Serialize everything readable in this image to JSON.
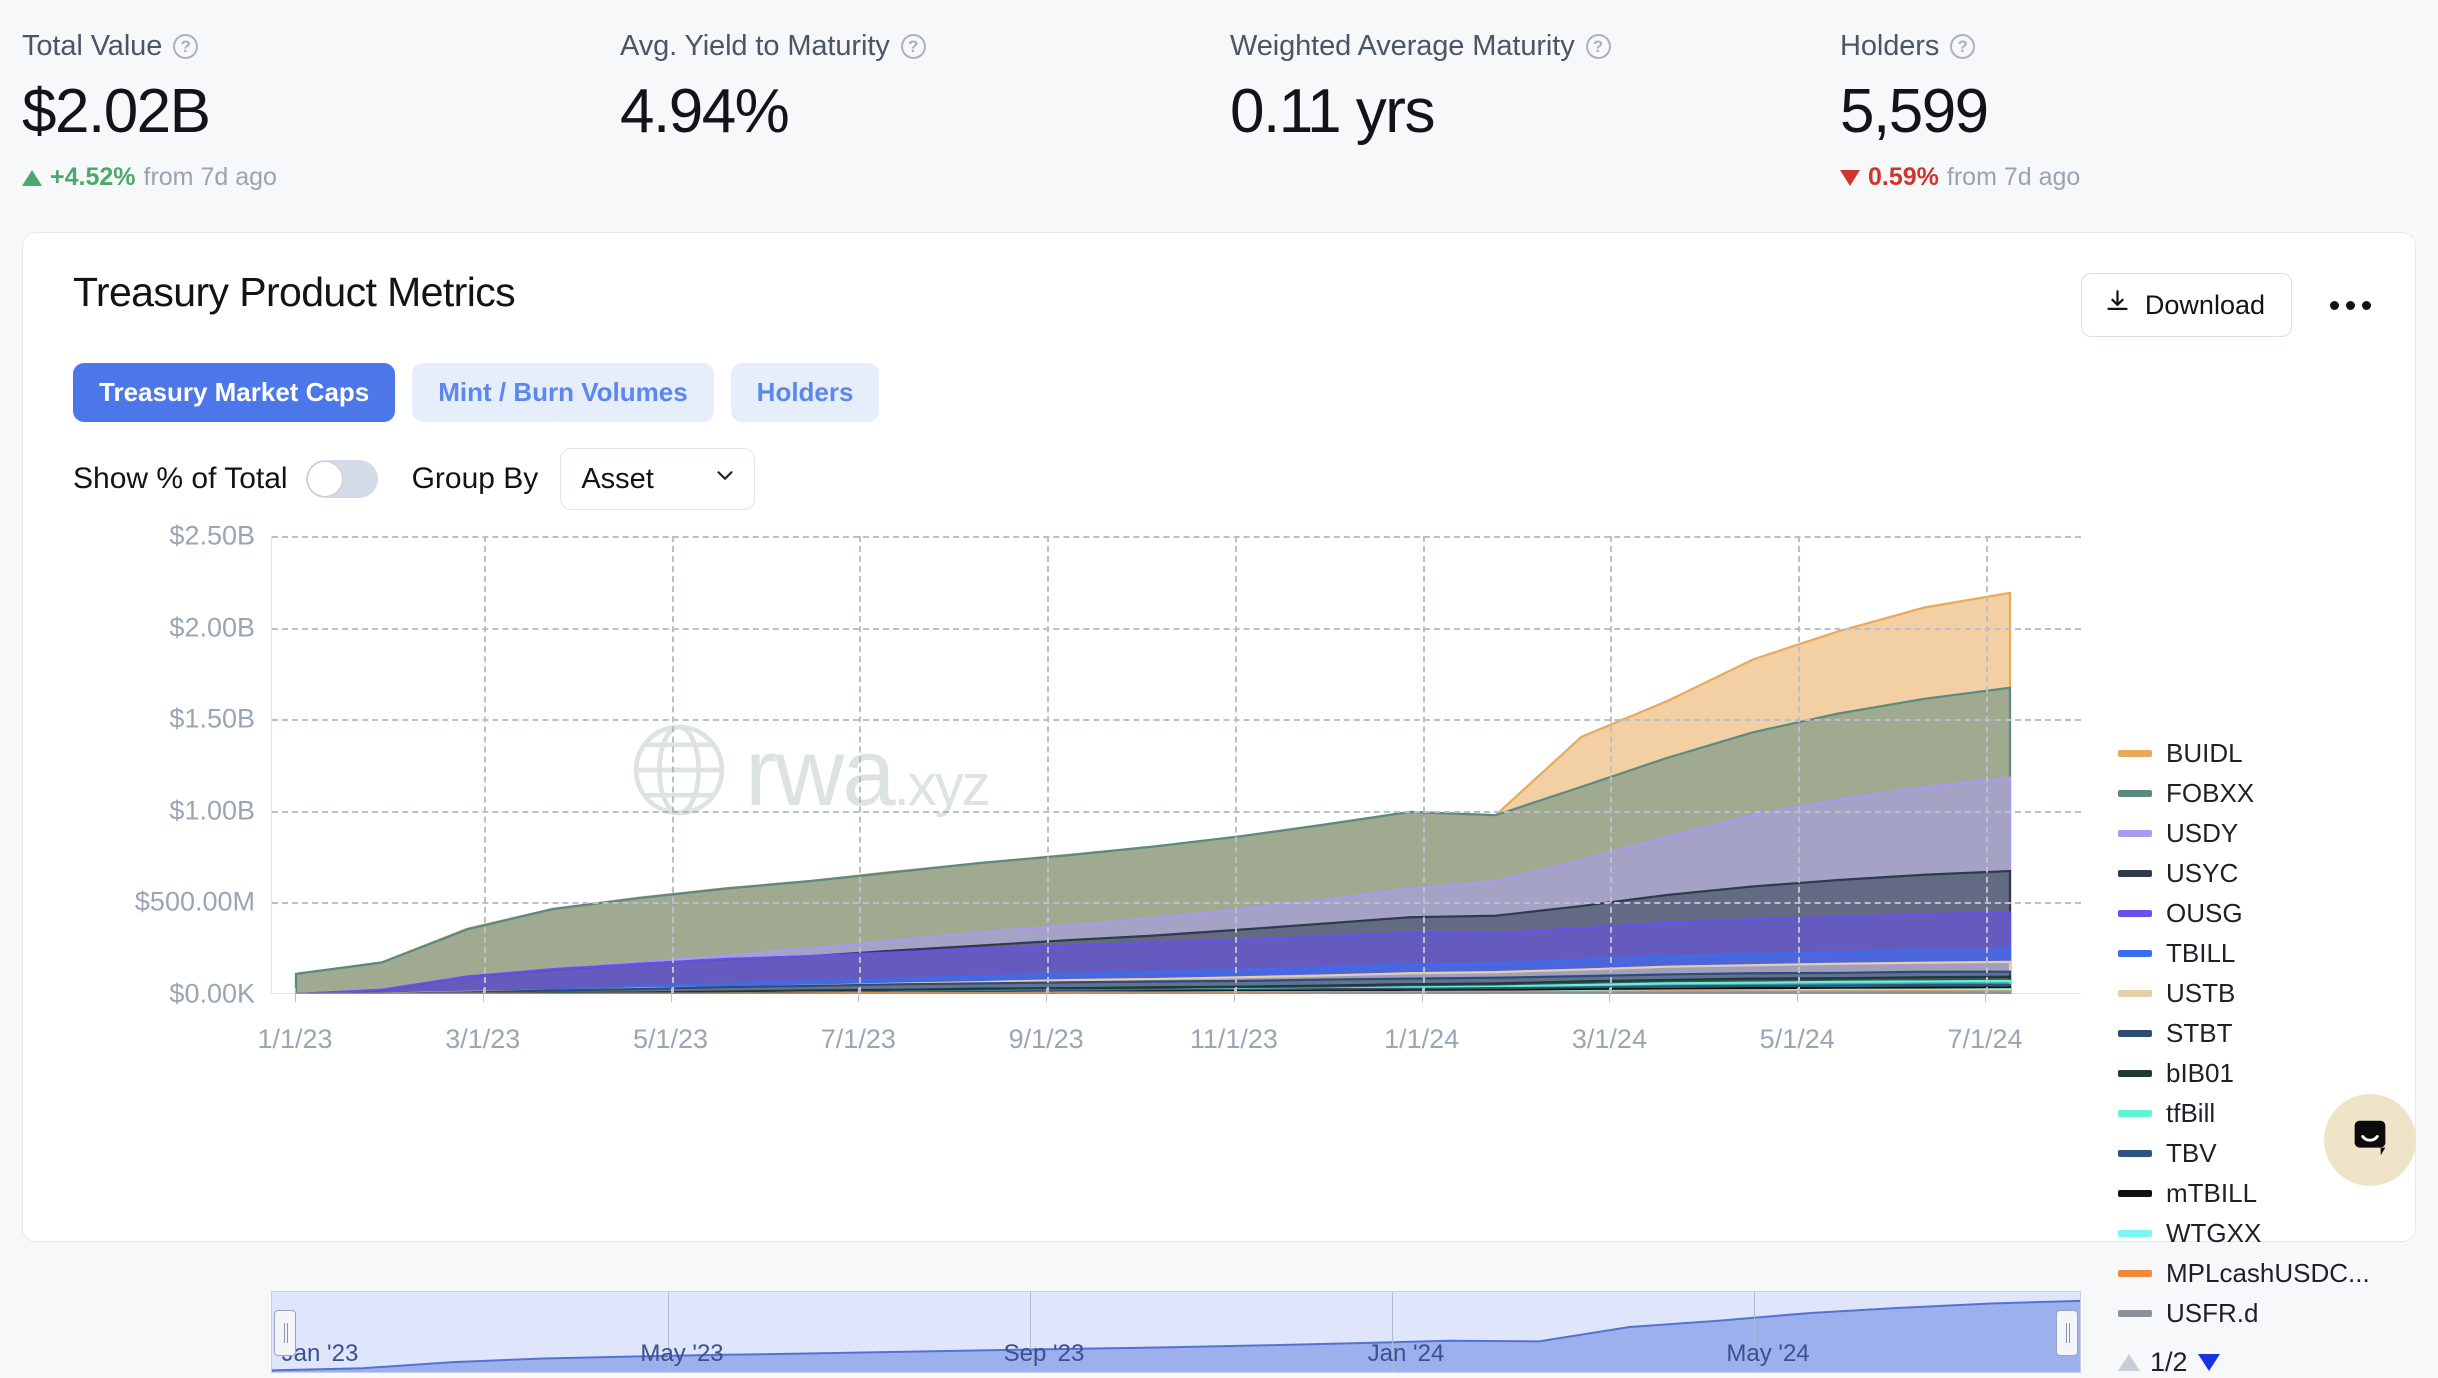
{
  "kpis": [
    {
      "label": "Total Value",
      "help_icon": "question-circle-icon",
      "value": "$2.02B",
      "delta_direction": "up",
      "delta_value": "+4.52%",
      "delta_suffix": "from 7d ago"
    },
    {
      "label": "Avg. Yield to Maturity",
      "help_icon": "question-circle-icon",
      "value": "4.94%",
      "delta_direction": "none",
      "delta_value": "",
      "delta_suffix": ""
    },
    {
      "label": "Weighted Average Maturity",
      "help_icon": "question-circle-icon",
      "value": "0.11 yrs",
      "delta_direction": "none",
      "delta_value": "",
      "delta_suffix": ""
    },
    {
      "label": "Holders",
      "help_icon": "question-circle-icon",
      "value": "5,599",
      "delta_direction": "down",
      "delta_value": "0.59%",
      "delta_suffix": "from 7d ago"
    }
  ],
  "card": {
    "title": "Treasury Product Metrics",
    "download_label": "Download",
    "download_icon": "download-icon",
    "overflow_icon": "ellipsis-icon",
    "tabs": [
      {
        "label": "Treasury Market Caps",
        "active": true
      },
      {
        "label": "Mint / Burn Volumes",
        "active": false
      },
      {
        "label": "Holders",
        "active": false
      }
    ],
    "controls": {
      "toggle_label": "Show % of Total",
      "toggle_on": false,
      "group_by_label": "Group By",
      "group_by_value": "Asset",
      "group_by_chevron": "chevron-down-icon"
    },
    "watermark": {
      "icon": "globe-icon",
      "text": "rwa",
      "suffix": ".xyz"
    },
    "legend_pager": {
      "text": "1/2",
      "up_icon": "triangle-up-icon",
      "down_icon": "triangle-down-icon"
    }
  },
  "chart_data": {
    "type": "area",
    "title": "Treasury Market Caps",
    "stacked": true,
    "grid": true,
    "legend_position": "right",
    "xlabel": "",
    "ylabel": "",
    "ylim": [
      0,
      2500000000
    ],
    "ytick_labels": [
      "$2.50B",
      "$2.00B",
      "$1.50B",
      "$1.00B",
      "$500.00M",
      "$0.00K"
    ],
    "ytick_values": [
      2500000000,
      2000000000,
      1500000000,
      1000000000,
      500000000,
      0
    ],
    "xtick_labels": [
      "1/1/23",
      "3/1/23",
      "5/1/23",
      "7/1/23",
      "9/1/23",
      "11/1/23",
      "1/1/24",
      "3/1/24",
      "5/1/24",
      "7/1/24"
    ],
    "x_range": [
      "1/1/23",
      "8/20/24"
    ],
    "series": [
      {
        "name": "BUIDL",
        "color": "#e8a95a",
        "values": [
          0,
          0,
          0,
          0,
          0,
          0,
          0,
          0,
          0,
          0,
          0,
          0,
          0,
          0,
          0,
          275,
          310,
          400,
          450,
          500,
          520
        ]
      },
      {
        "name": "FOBXX",
        "color": "#5b8a80",
        "values": [
          110,
          150,
          260,
          330,
          355,
          365,
          370,
          375,
          380,
          385,
          390,
          400,
          410,
          420,
          360,
          400,
          430,
          450,
          470,
          480,
          490
        ]
      },
      {
        "name": "USDY",
        "color": "#a89bf0",
        "values": [
          0,
          0,
          0,
          0,
          5,
          20,
          40,
          55,
          70,
          80,
          95,
          110,
          130,
          155,
          190,
          250,
          320,
          390,
          440,
          480,
          510
        ]
      },
      {
        "name": "USYC",
        "color": "#2f3a4f",
        "values": [
          0,
          0,
          0,
          0,
          0,
          0,
          0,
          10,
          20,
          30,
          40,
          55,
          70,
          85,
          95,
          120,
          150,
          180,
          200,
          215,
          225
        ]
      },
      {
        "name": "OUSG",
        "color": "#6650ee",
        "values": [
          0,
          20,
          85,
          110,
          125,
          135,
          140,
          145,
          150,
          155,
          160,
          165,
          170,
          175,
          165,
          175,
          185,
          190,
          195,
          200,
          205
        ]
      },
      {
        "name": "TBILL",
        "color": "#3a6ef0",
        "values": [
          0,
          0,
          0,
          5,
          12,
          18,
          22,
          26,
          30,
          33,
          36,
          39,
          42,
          45,
          46,
          50,
          55,
          58,
          61,
          63,
          65
        ]
      },
      {
        "name": "USTB",
        "color": "#e6cfa8",
        "values": [
          0,
          0,
          0,
          0,
          0,
          0,
          0,
          4,
          8,
          12,
          16,
          20,
          25,
          30,
          33,
          38,
          43,
          47,
          50,
          52,
          54
        ]
      },
      {
        "name": "STBT",
        "color": "#2f4c73",
        "values": [
          0,
          2,
          8,
          14,
          20,
          24,
          26,
          28,
          29,
          30,
          30,
          30,
          30,
          30,
          28,
          28,
          28,
          28,
          28,
          28,
          28
        ]
      },
      {
        "name": "bIB01",
        "color": "#1f3b33",
        "values": [
          0,
          0,
          2,
          5,
          8,
          10,
          12,
          13,
          14,
          15,
          16,
          17,
          18,
          19,
          19,
          20,
          21,
          22,
          22,
          23,
          23
        ]
      },
      {
        "name": "tfBill",
        "color": "#63f2d8",
        "values": [
          0,
          0,
          0,
          0,
          0,
          0,
          0,
          0,
          0,
          0,
          0,
          0,
          2,
          5,
          8,
          12,
          15,
          17,
          18,
          19,
          20
        ]
      },
      {
        "name": "TBV",
        "color": "#2d5580",
        "values": [
          0,
          0,
          0,
          0,
          0,
          2,
          4,
          6,
          7,
          8,
          9,
          10,
          11,
          12,
          12,
          13,
          14,
          14,
          15,
          15,
          15
        ]
      },
      {
        "name": "mTBILL",
        "color": "#101114",
        "values": [
          0,
          0,
          0,
          0,
          0,
          0,
          0,
          0,
          2,
          3,
          4,
          5,
          6,
          7,
          7,
          8,
          9,
          10,
          10,
          11,
          11
        ]
      },
      {
        "name": "WTGXX",
        "color": "#7df5f5",
        "values": [
          0,
          0,
          0,
          0,
          0,
          0,
          0,
          0,
          0,
          0,
          0,
          0,
          0,
          0,
          2,
          4,
          6,
          7,
          8,
          9,
          10
        ]
      },
      {
        "name": "MPLcashUSDC...",
        "color": "#ef8a3c",
        "values": [
          0,
          0,
          0,
          0,
          0,
          1,
          2,
          3,
          4,
          4,
          5,
          5,
          6,
          6,
          6,
          7,
          7,
          8,
          8,
          8,
          8
        ]
      },
      {
        "name": "USFR.d",
        "color": "#8d9299",
        "values": [
          0,
          0,
          0,
          0,
          0,
          0,
          1,
          2,
          2,
          3,
          3,
          4,
          4,
          5,
          5,
          5,
          6,
          6,
          6,
          7,
          7
        ]
      }
    ],
    "units": "millions USD",
    "range_selector": {
      "labels": [
        "Jan '23",
        "May '23",
        "Sep '23",
        "Jan '24",
        "May '24"
      ],
      "selection_start": "1/1/23",
      "selection_end": "8/20/24"
    }
  }
}
